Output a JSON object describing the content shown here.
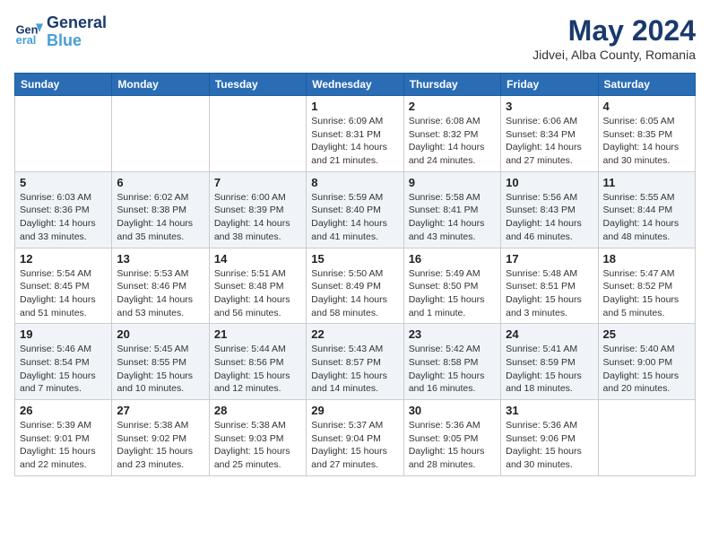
{
  "header": {
    "logo_line1": "General",
    "logo_line2": "Blue",
    "month_year": "May 2024",
    "location": "Jidvei, Alba County, Romania"
  },
  "weekdays": [
    "Sunday",
    "Monday",
    "Tuesday",
    "Wednesday",
    "Thursday",
    "Friday",
    "Saturday"
  ],
  "weeks": [
    [
      {
        "day": "",
        "info": ""
      },
      {
        "day": "",
        "info": ""
      },
      {
        "day": "",
        "info": ""
      },
      {
        "day": "1",
        "info": "Sunrise: 6:09 AM\nSunset: 8:31 PM\nDaylight: 14 hours\nand 21 minutes."
      },
      {
        "day": "2",
        "info": "Sunrise: 6:08 AM\nSunset: 8:32 PM\nDaylight: 14 hours\nand 24 minutes."
      },
      {
        "day": "3",
        "info": "Sunrise: 6:06 AM\nSunset: 8:34 PM\nDaylight: 14 hours\nand 27 minutes."
      },
      {
        "day": "4",
        "info": "Sunrise: 6:05 AM\nSunset: 8:35 PM\nDaylight: 14 hours\nand 30 minutes."
      }
    ],
    [
      {
        "day": "5",
        "info": "Sunrise: 6:03 AM\nSunset: 8:36 PM\nDaylight: 14 hours\nand 33 minutes."
      },
      {
        "day": "6",
        "info": "Sunrise: 6:02 AM\nSunset: 8:38 PM\nDaylight: 14 hours\nand 35 minutes."
      },
      {
        "day": "7",
        "info": "Sunrise: 6:00 AM\nSunset: 8:39 PM\nDaylight: 14 hours\nand 38 minutes."
      },
      {
        "day": "8",
        "info": "Sunrise: 5:59 AM\nSunset: 8:40 PM\nDaylight: 14 hours\nand 41 minutes."
      },
      {
        "day": "9",
        "info": "Sunrise: 5:58 AM\nSunset: 8:41 PM\nDaylight: 14 hours\nand 43 minutes."
      },
      {
        "day": "10",
        "info": "Sunrise: 5:56 AM\nSunset: 8:43 PM\nDaylight: 14 hours\nand 46 minutes."
      },
      {
        "day": "11",
        "info": "Sunrise: 5:55 AM\nSunset: 8:44 PM\nDaylight: 14 hours\nand 48 minutes."
      }
    ],
    [
      {
        "day": "12",
        "info": "Sunrise: 5:54 AM\nSunset: 8:45 PM\nDaylight: 14 hours\nand 51 minutes."
      },
      {
        "day": "13",
        "info": "Sunrise: 5:53 AM\nSunset: 8:46 PM\nDaylight: 14 hours\nand 53 minutes."
      },
      {
        "day": "14",
        "info": "Sunrise: 5:51 AM\nSunset: 8:48 PM\nDaylight: 14 hours\nand 56 minutes."
      },
      {
        "day": "15",
        "info": "Sunrise: 5:50 AM\nSunset: 8:49 PM\nDaylight: 14 hours\nand 58 minutes."
      },
      {
        "day": "16",
        "info": "Sunrise: 5:49 AM\nSunset: 8:50 PM\nDaylight: 15 hours\nand 1 minute."
      },
      {
        "day": "17",
        "info": "Sunrise: 5:48 AM\nSunset: 8:51 PM\nDaylight: 15 hours\nand 3 minutes."
      },
      {
        "day": "18",
        "info": "Sunrise: 5:47 AM\nSunset: 8:52 PM\nDaylight: 15 hours\nand 5 minutes."
      }
    ],
    [
      {
        "day": "19",
        "info": "Sunrise: 5:46 AM\nSunset: 8:54 PM\nDaylight: 15 hours\nand 7 minutes."
      },
      {
        "day": "20",
        "info": "Sunrise: 5:45 AM\nSunset: 8:55 PM\nDaylight: 15 hours\nand 10 minutes."
      },
      {
        "day": "21",
        "info": "Sunrise: 5:44 AM\nSunset: 8:56 PM\nDaylight: 15 hours\nand 12 minutes."
      },
      {
        "day": "22",
        "info": "Sunrise: 5:43 AM\nSunset: 8:57 PM\nDaylight: 15 hours\nand 14 minutes."
      },
      {
        "day": "23",
        "info": "Sunrise: 5:42 AM\nSunset: 8:58 PM\nDaylight: 15 hours\nand 16 minutes."
      },
      {
        "day": "24",
        "info": "Sunrise: 5:41 AM\nSunset: 8:59 PM\nDaylight: 15 hours\nand 18 minutes."
      },
      {
        "day": "25",
        "info": "Sunrise: 5:40 AM\nSunset: 9:00 PM\nDaylight: 15 hours\nand 20 minutes."
      }
    ],
    [
      {
        "day": "26",
        "info": "Sunrise: 5:39 AM\nSunset: 9:01 PM\nDaylight: 15 hours\nand 22 minutes."
      },
      {
        "day": "27",
        "info": "Sunrise: 5:38 AM\nSunset: 9:02 PM\nDaylight: 15 hours\nand 23 minutes."
      },
      {
        "day": "28",
        "info": "Sunrise: 5:38 AM\nSunset: 9:03 PM\nDaylight: 15 hours\nand 25 minutes."
      },
      {
        "day": "29",
        "info": "Sunrise: 5:37 AM\nSunset: 9:04 PM\nDaylight: 15 hours\nand 27 minutes."
      },
      {
        "day": "30",
        "info": "Sunrise: 5:36 AM\nSunset: 9:05 PM\nDaylight: 15 hours\nand 28 minutes."
      },
      {
        "day": "31",
        "info": "Sunrise: 5:36 AM\nSunset: 9:06 PM\nDaylight: 15 hours\nand 30 minutes."
      },
      {
        "day": "",
        "info": ""
      }
    ]
  ]
}
